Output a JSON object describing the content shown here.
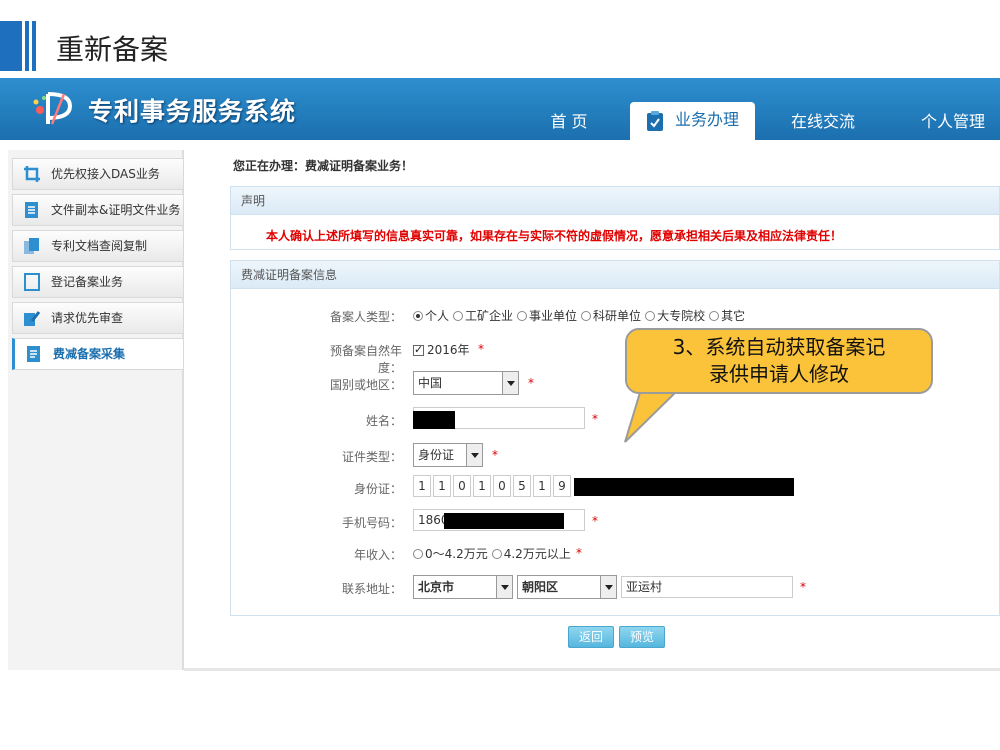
{
  "slide": {
    "title": "重新备案"
  },
  "app": {
    "name": "专利事务服务系统",
    "nav": [
      {
        "label": "首 页"
      },
      {
        "label": "业务办理"
      },
      {
        "label": "在线交流"
      },
      {
        "label": "个人管理"
      }
    ]
  },
  "sidebar": {
    "items": [
      {
        "label": "优先权接入DAS业务",
        "icon": "crop-icon"
      },
      {
        "label": "文件副本&证明文件业务",
        "icon": "document-icon"
      },
      {
        "label": "专利文档查阅复制",
        "icon": "copy-icon"
      },
      {
        "label": "登记备案业务",
        "icon": "page-icon"
      },
      {
        "label": "请求优先审查",
        "icon": "edit-icon"
      },
      {
        "label": "费减备案采集",
        "icon": "list-icon"
      }
    ]
  },
  "main": {
    "breadcrumb": "您正在办理：费减证明备案业务！",
    "notice": {
      "title": "声明",
      "text": "本人确认上述所填写的信息真实可靠，如果存在与实际不符的虚假情况，愿意承担相关后果及相应法律责任！"
    },
    "form": {
      "title": "费减证明备案信息",
      "filer_type": {
        "label": "备案人类型：",
        "options": [
          "个人",
          "工矿企业",
          "事业单位",
          "科研单位",
          "大专院校",
          "其它"
        ],
        "selected": "个人"
      },
      "year": {
        "label": "预备案自然年度：",
        "value": "2016年"
      },
      "country": {
        "label": "国别或地区：",
        "value": "中国"
      },
      "name": {
        "label": "姓名："
      },
      "id_type": {
        "label": "证件类型：",
        "value": "身份证"
      },
      "id_number": {
        "label": "身份证：",
        "digits": [
          "1",
          "1",
          "0",
          "1",
          "0",
          "5",
          "1",
          "9"
        ]
      },
      "phone": {
        "label": "手机号码：",
        "value": "1860"
      },
      "income": {
        "label": "年收入：",
        "options": [
          "0～4.2万元",
          "4.2万元以上"
        ]
      },
      "address": {
        "label": "联系地址：",
        "city": "北京市",
        "district": "朝阳区",
        "street": "亚运村"
      },
      "required_mark": "*"
    },
    "buttons": {
      "back": "返回",
      "preview": "预览"
    }
  },
  "callout": {
    "line1": "3、系统自动获取备案记",
    "line2": "录供申请人修改"
  },
  "colors": {
    "header": "#1c6fae",
    "accent": "#2d8fcf",
    "warning": "#e00000",
    "callout": "#fbc33a"
  }
}
